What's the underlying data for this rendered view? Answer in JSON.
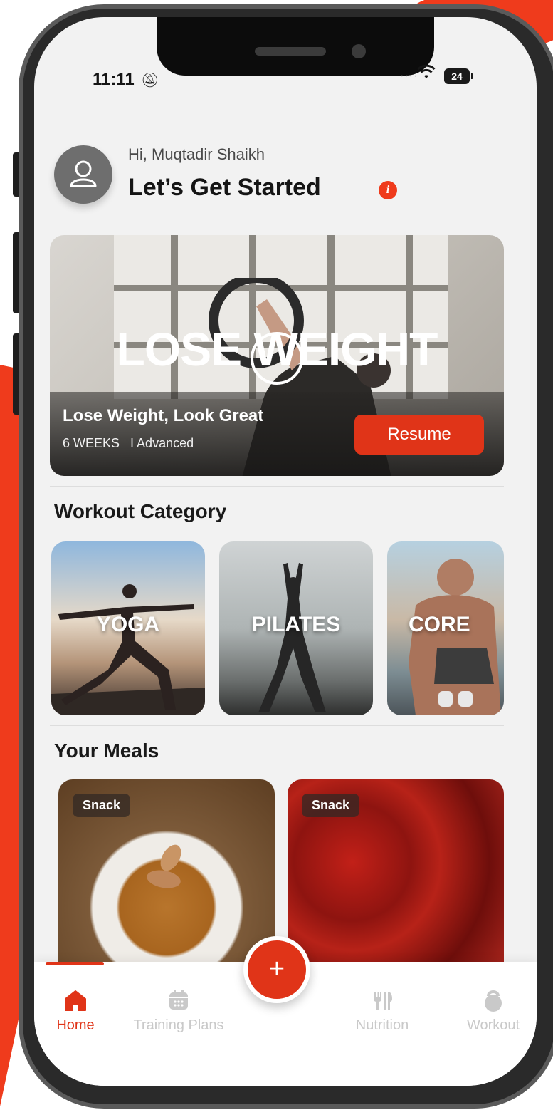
{
  "status_bar": {
    "time": "11:11",
    "battery": "24"
  },
  "header": {
    "greeting": "Hi, Muqtadir Shaikh",
    "title": "Let’s Get Started"
  },
  "hero": {
    "banner_text": "LOSE WEIGHT",
    "name": "Lose Weight, Look Great",
    "duration": "6 WEEKS",
    "level": "I Advanced",
    "resume_label": "Resume"
  },
  "workout_category": {
    "title": "Workout Category",
    "items": [
      {
        "label": "YOGA"
      },
      {
        "label": "PILATES"
      },
      {
        "label": "CORE"
      }
    ]
  },
  "meals": {
    "title": "Your Meals",
    "items": [
      {
        "badge": "Snack"
      },
      {
        "badge": "Snack"
      }
    ]
  },
  "fab_label": "+",
  "nav": {
    "items": [
      {
        "label": "Home",
        "icon": "home-icon"
      },
      {
        "label": "Training Plans",
        "icon": "calendar-icon"
      },
      {
        "label": "Nutrition",
        "icon": "utensils-icon"
      },
      {
        "label": "Workout",
        "icon": "kettlebell-icon"
      }
    ]
  },
  "colors": {
    "accent": "#e03418",
    "brand_bg": "#ef3b1c"
  }
}
